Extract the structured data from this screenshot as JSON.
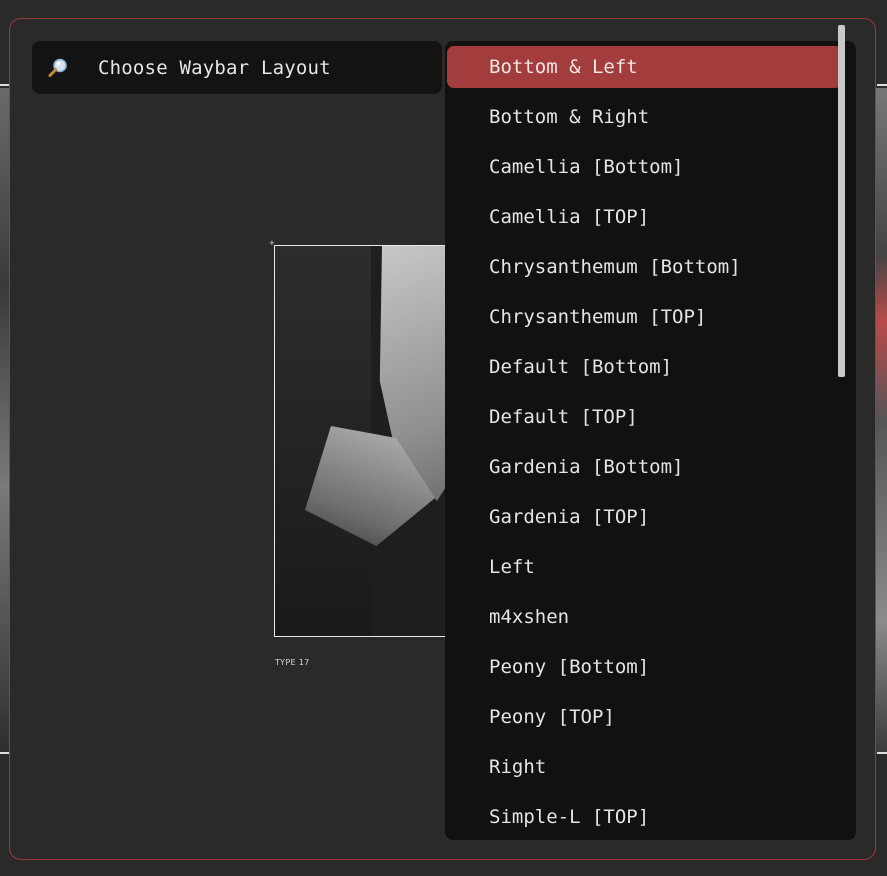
{
  "search": {
    "icon": "magnifier-icon",
    "prompt": "Choose Waybar Layout"
  },
  "preview": {
    "caption": "TYPE 17",
    "marker": "+"
  },
  "layouts": {
    "selected_index": 0,
    "items": [
      "Bottom & Left",
      "Bottom & Right",
      "Camellia [Bottom]",
      "Camellia [TOP]",
      "Chrysanthemum [Bottom]",
      "Chrysanthemum [TOP]",
      "Default [Bottom]",
      "Default [TOP]",
      "Gardenia [Bottom]",
      "Gardenia [TOP]",
      "Left",
      "m4xshen",
      "Peony [Bottom]",
      "Peony [TOP]",
      "Right",
      "Simple-L [TOP]"
    ]
  },
  "colors": {
    "accent": "#a33c3c",
    "border": "#9a3b3b",
    "panel": "#111111",
    "background": "#2a2a2a",
    "text": "#e4e4e4"
  }
}
